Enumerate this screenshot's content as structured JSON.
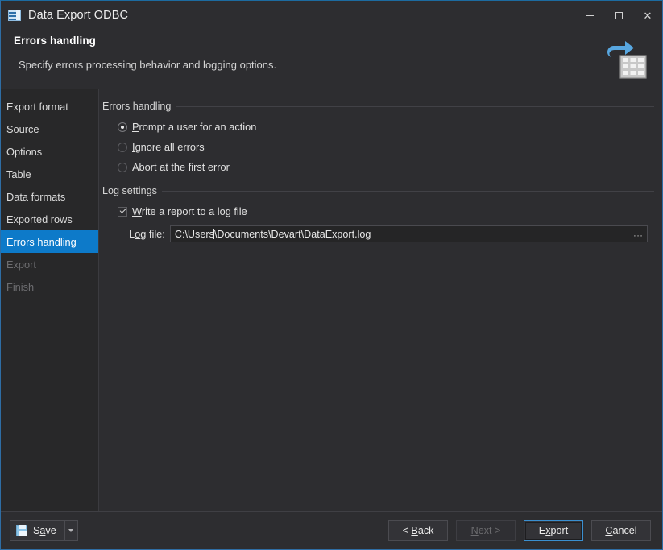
{
  "window": {
    "title": "Data Export ODBC",
    "app_icon": "grid-table-icon",
    "controls": {
      "minimize": "minimize-icon",
      "maximize": "maximize-icon",
      "close": "close-icon"
    },
    "accent_color": "#0d7ac9",
    "border_color": "#2e6da4",
    "background_color": "#2d2d30"
  },
  "header": {
    "title": "Errors handling",
    "subtitle": "Specify errors processing behavior and logging options.",
    "logo": "export-table-arrow-icon"
  },
  "sidebar": {
    "items": [
      {
        "label": "Export format",
        "state": "enabled"
      },
      {
        "label": "Source",
        "state": "enabled"
      },
      {
        "label": "Options",
        "state": "enabled"
      },
      {
        "label": "Table",
        "state": "enabled"
      },
      {
        "label": "Data formats",
        "state": "enabled"
      },
      {
        "label": "Exported rows",
        "state": "enabled"
      },
      {
        "label": "Errors handling",
        "state": "active"
      },
      {
        "label": "Export",
        "state": "disabled"
      },
      {
        "label": "Finish",
        "state": "disabled"
      }
    ]
  },
  "main": {
    "errors_group": {
      "label": "Errors handling",
      "options": [
        {
          "prefix": "",
          "mnemonic": "P",
          "suffix": "rompt a user for an action",
          "checked": true
        },
        {
          "prefix": "",
          "mnemonic": "I",
          "suffix": "gnore all errors",
          "checked": false
        },
        {
          "prefix": "",
          "mnemonic": "A",
          "suffix": "bort at the first error",
          "checked": false
        }
      ]
    },
    "log_group": {
      "label": "Log settings",
      "checkbox": {
        "prefix": "",
        "mnemonic": "W",
        "suffix": "rite a report to a log file",
        "checked": true
      },
      "log_file": {
        "label_prefix": "L",
        "label_mnemonic": "o",
        "label_suffix": "g file:",
        "value_before_caret": "C:\\Users",
        "value_after_caret": "\\Documents\\Devart\\DataExport.log",
        "full_value": "C:\\Users\\Documents\\Devart\\DataExport.log",
        "browse_label": "...",
        "browse_icon": "ellipsis-icon"
      }
    }
  },
  "footer": {
    "save": {
      "prefix": "S",
      "mnemonic": "a",
      "suffix": "ve",
      "icon": "floppy-disk-icon",
      "dropdown_icon": "chevron-down-icon"
    },
    "buttons": [
      {
        "prefix": "< ",
        "mnemonic": "B",
        "suffix": "ack",
        "state": "enabled",
        "name": "back-button"
      },
      {
        "prefix": "",
        "mnemonic": "N",
        "suffix": "ext >",
        "state": "disabled",
        "name": "next-button"
      },
      {
        "prefix": "E",
        "mnemonic": "x",
        "suffix": "port",
        "state": "focused",
        "name": "export-button"
      },
      {
        "prefix": "",
        "mnemonic": "C",
        "suffix": "ancel",
        "state": "enabled",
        "name": "cancel-button"
      }
    ]
  }
}
